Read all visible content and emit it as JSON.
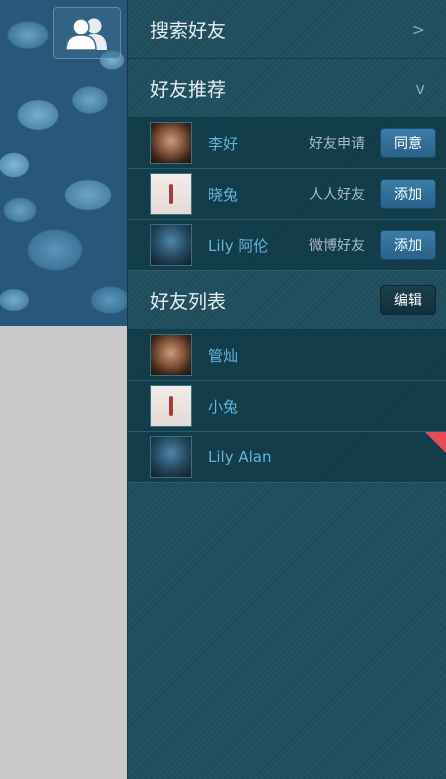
{
  "search": {
    "label": "搜索好友",
    "chevron": ">"
  },
  "recommend": {
    "title": "好友推荐",
    "chevron": "v",
    "items": [
      {
        "name": "李好",
        "source": "好友申请",
        "action": "同意",
        "avatar": "avatar-face"
      },
      {
        "name": "晓兔",
        "source": "人人好友",
        "action": "添加",
        "avatar": "avatar-rabbit"
      },
      {
        "name": "Lily 阿伦",
        "source": "微博好友",
        "action": "添加",
        "avatar": "avatar-lily"
      }
    ]
  },
  "friends": {
    "title": "好友列表",
    "edit_label": "编辑",
    "items": [
      {
        "name": "管灿",
        "avatar": "avatar-face"
      },
      {
        "name": "小兔",
        "avatar": "avatar-rabbit"
      },
      {
        "name": "Lily Alan",
        "avatar": "avatar-lily"
      }
    ]
  },
  "colors": {
    "panel_bg": "#1f4e5e",
    "name_text": "#62b6de",
    "button_blue": "#2f6f98",
    "flag_red": "#e84a5a"
  },
  "icons": [
    "friends-icon",
    "chevron-right-icon",
    "chevron-down-icon"
  ]
}
